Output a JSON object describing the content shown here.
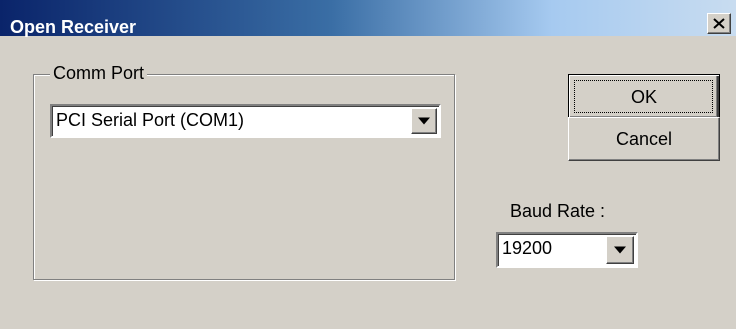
{
  "window": {
    "title": "Open Receiver",
    "colors": {
      "face": "#d4d0c8",
      "title_start": "#0a246a",
      "title_end": "#a6caf0"
    }
  },
  "comm_port": {
    "group_label": "Comm Port",
    "selected": "PCI Serial Port (COM1)"
  },
  "buttons": {
    "ok_label": "OK",
    "cancel_label": "Cancel"
  },
  "baud": {
    "label": "Baud Rate :",
    "selected": "19200"
  },
  "icons": {
    "close": "close-icon",
    "dropdown": "chevron-down-icon"
  }
}
